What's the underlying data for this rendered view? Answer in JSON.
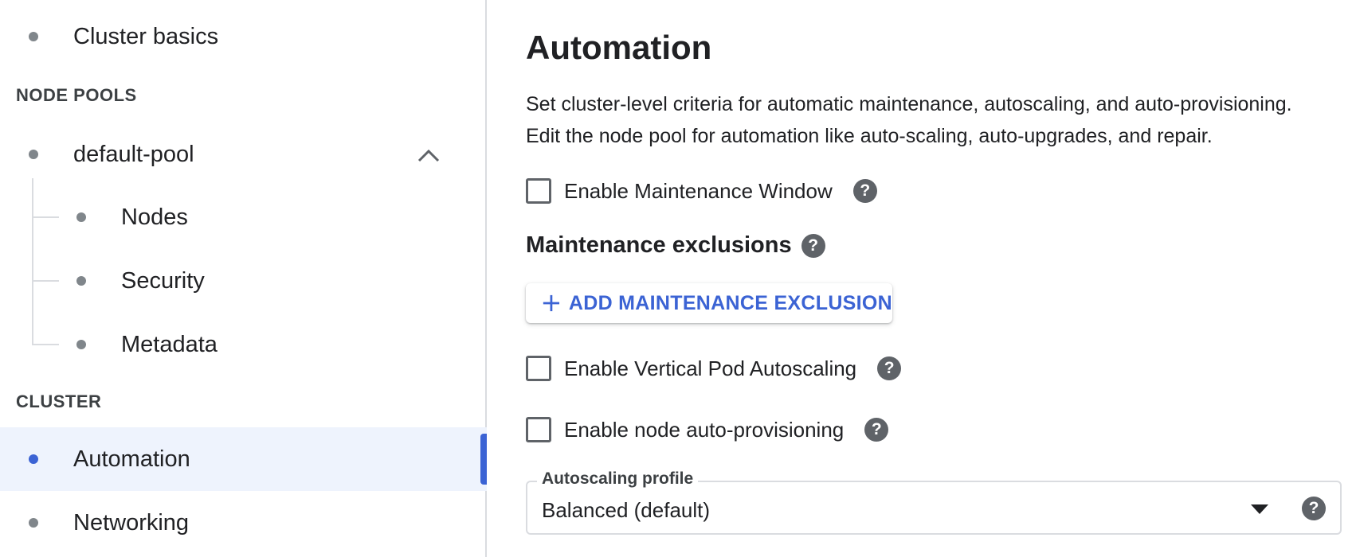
{
  "sidebar": {
    "top_item": {
      "label": "Cluster basics"
    },
    "node_pools_header": "NODE POOLS",
    "pool": {
      "label": "default-pool",
      "children": [
        {
          "label": "Nodes"
        },
        {
          "label": "Security"
        },
        {
          "label": "Metadata"
        }
      ]
    },
    "cluster_header": "CLUSTER",
    "cluster_items": [
      {
        "label": "Automation",
        "active": true
      },
      {
        "label": "Networking",
        "active": false
      }
    ]
  },
  "main": {
    "title": "Automation",
    "description_line1": "Set cluster-level criteria for automatic maintenance, autoscaling, and auto-provisioning.",
    "description_line2": "Edit the node pool for automation like auto-scaling, auto-upgrades, and repair.",
    "maintenance_window": {
      "label": "Enable Maintenance Window",
      "checked": false
    },
    "exclusions": {
      "title": "Maintenance exclusions",
      "add_button": "ADD MAINTENANCE EXCLUSION"
    },
    "vertical_pod_autoscaling": {
      "label": "Enable Vertical Pod Autoscaling",
      "checked": false
    },
    "node_auto_provisioning": {
      "label": "Enable node auto-provisioning",
      "checked": false
    },
    "autoscaling_profile": {
      "label": "Autoscaling profile",
      "value": "Balanced (default)"
    },
    "help_glyph": "?"
  },
  "colors": {
    "accent": "#3b63d4",
    "active_bg": "#eef3fd",
    "icon_gray": "#5f6368",
    "divider": "#dadce0"
  },
  "icons": {
    "pool_toggle": "chevron-up-icon",
    "add": "plus-icon",
    "help": "help-icon",
    "dropdown": "arrow-drop-down-icon"
  }
}
